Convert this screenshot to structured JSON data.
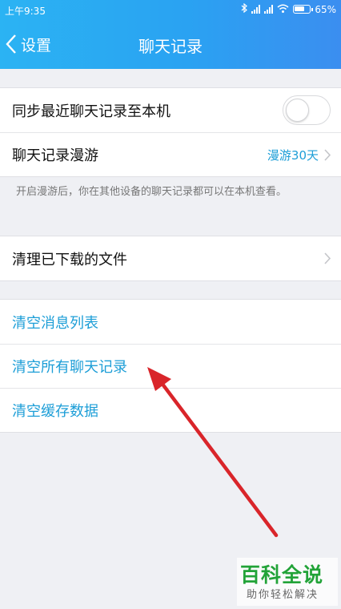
{
  "status_bar": {
    "time": "上午9:35",
    "battery": "65%"
  },
  "nav": {
    "back_label": "设置",
    "title": "聊天记录"
  },
  "sync_section": {
    "sync_label": "同步最近聊天记录至本机",
    "sync_toggle_on": false,
    "roaming_label": "聊天记录漫游",
    "roaming_value": "漫游30天",
    "hint": "开启漫游后，你在其他设备的聊天记录都可以在本机查看。"
  },
  "files_section": {
    "clean_files_label": "清理已下载的文件"
  },
  "clear_section": {
    "clear_messages": "清空消息列表",
    "clear_all_chats": "清空所有聊天记录",
    "clear_cache": "清空缓存数据"
  },
  "watermark": {
    "logo": "百科全说",
    "tagline": "助你轻松解决"
  },
  "colors": {
    "header": "#2aa2f2",
    "link": "#1d9ed7",
    "arrow": "#d9252a",
    "background": "#eff0f4"
  }
}
